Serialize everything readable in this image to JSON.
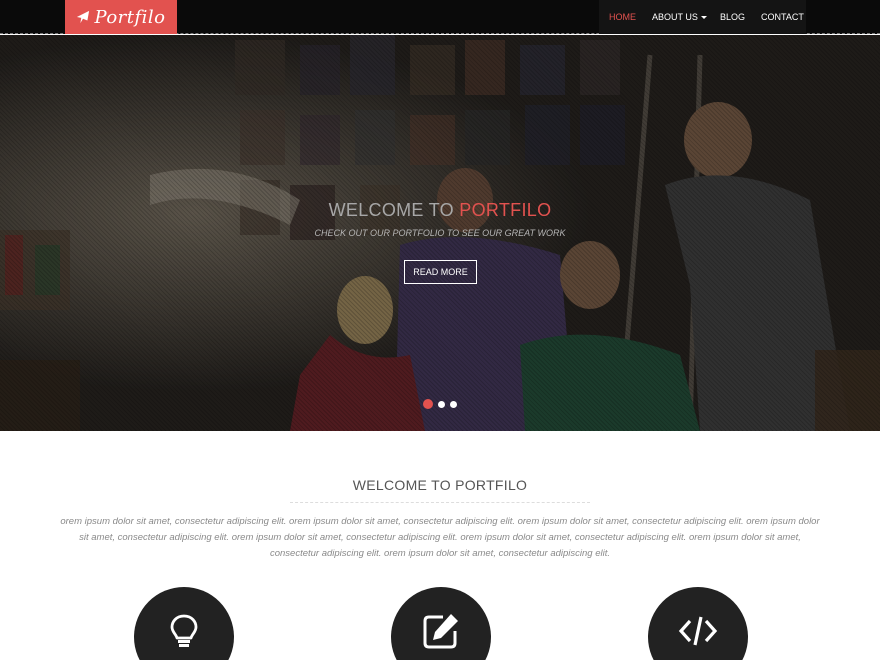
{
  "brand": {
    "name": "Portfilo",
    "color": "#e2524f",
    "icon": "paper-plane-icon"
  },
  "nav": {
    "items": [
      {
        "label": "HOME",
        "active": true
      },
      {
        "label": "ABOUT US",
        "dropdown": true
      },
      {
        "label": "BLOG"
      },
      {
        "label": "CONTACT"
      }
    ]
  },
  "hero": {
    "title_prefix": "WELCOME TO",
    "title_accent": "PORTFILO",
    "subtitle": "CHECK OUT OUR PORTFOLIO TO SEE OUR GREAT WORK",
    "button_label": "READ MORE",
    "slides": 3,
    "active_slide": 1
  },
  "welcome": {
    "title": "WELCOME TO PORTFILO",
    "text": "orem ipsum dolor sit amet, consectetur adipiscing elit. orem ipsum dolor sit amet, consectetur adipiscing elit. orem ipsum dolor sit amet, consectetur adipiscing elit. orem ipsum dolor sit amet, consectetur adipiscing elit. orem ipsum dolor sit amet, consectetur adipiscing elit. orem ipsum dolor sit amet, consectetur adipiscing elit. orem ipsum dolor sit amet, consectetur adipiscing elit. orem ipsum dolor sit amet, consectetur adipiscing elit."
  },
  "features": [
    {
      "icon": "lightbulb-icon"
    },
    {
      "icon": "edit-icon"
    },
    {
      "icon": "code-icon"
    }
  ],
  "colors": {
    "accent": "#e2524f",
    "navbar": "#0a0a0a",
    "feature_circle": "#222222"
  }
}
